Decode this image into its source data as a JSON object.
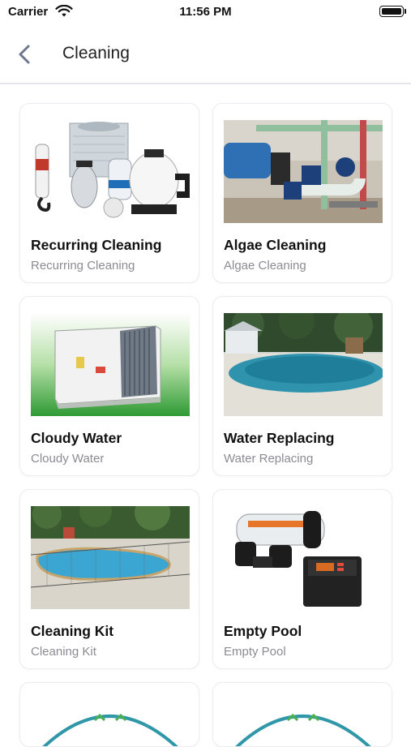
{
  "status_bar": {
    "carrier": "Carrier",
    "time": "11:56 PM"
  },
  "nav": {
    "title": "Cleaning"
  },
  "services": [
    {
      "title": "Recurring Cleaning",
      "subtitle": "Recurring Cleaning"
    },
    {
      "title": "Algae Cleaning",
      "subtitle": "Algae Cleaning"
    },
    {
      "title": "Cloudy Water",
      "subtitle": "Cloudy Water"
    },
    {
      "title": "Water Replacing",
      "subtitle": "Water Replacing"
    },
    {
      "title": "Cleaning Kit",
      "subtitle": "Cleaning Kit"
    },
    {
      "title": "Empty Pool",
      "subtitle": "Empty Pool"
    }
  ],
  "colors": {
    "accent": "#6f7790",
    "subtitle": "#8b8b93",
    "border": "#ececf1",
    "logo_teal": "#2f97a8"
  }
}
